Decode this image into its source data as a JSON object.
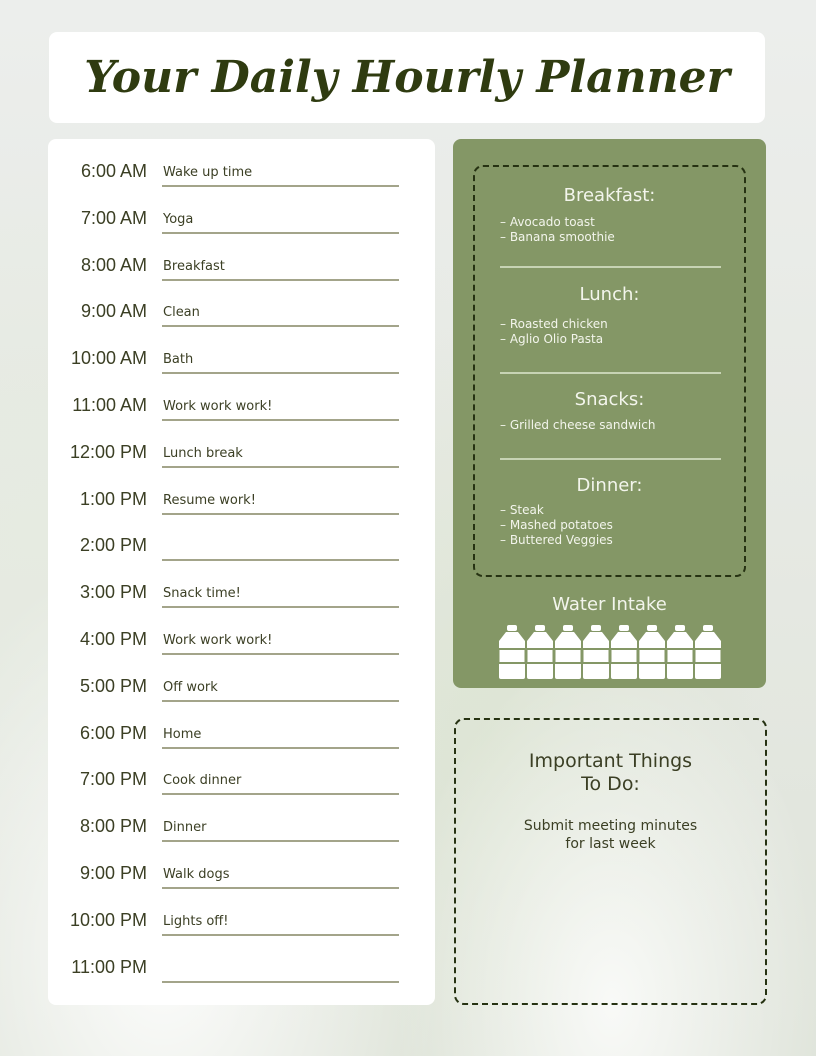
{
  "header": {
    "title": "Your Daily Hourly Planner"
  },
  "schedule": [
    {
      "time": "6:00 AM",
      "task": "Wake up time"
    },
    {
      "time": "7:00 AM",
      "task": "Yoga"
    },
    {
      "time": "8:00 AM",
      "task": "Breakfast"
    },
    {
      "time": "9:00 AM",
      "task": "Clean"
    },
    {
      "time": "10:00 AM",
      "task": "Bath"
    },
    {
      "time": "11:00 AM",
      "task": "Work work work!"
    },
    {
      "time": "12:00 PM",
      "task": "Lunch break"
    },
    {
      "time": "1:00 PM",
      "task": "Resume work!"
    },
    {
      "time": "2:00 PM",
      "task": ""
    },
    {
      "time": "3:00 PM",
      "task": "Snack time!"
    },
    {
      "time": "4:00 PM",
      "task": "Work work work!"
    },
    {
      "time": "5:00 PM",
      "task": "Off work"
    },
    {
      "time": "6:00 PM",
      "task": "Home"
    },
    {
      "time": "7:00 PM",
      "task": "Cook dinner"
    },
    {
      "time": "8:00 PM",
      "task": "Dinner"
    },
    {
      "time": "9:00 PM",
      "task": "Walk dogs"
    },
    {
      "time": "10:00 PM",
      "task": "Lights off!"
    },
    {
      "time": "11:00 PM",
      "task": ""
    }
  ],
  "meals": {
    "breakfast": {
      "title": "Breakfast:",
      "items": [
        "– Avocado toast",
        "– Banana smoothie"
      ]
    },
    "lunch": {
      "title": "Lunch:",
      "items": [
        "– Roasted chicken",
        "– Aglio Olio Pasta"
      ]
    },
    "snacks": {
      "title": "Snacks:",
      "items": [
        "– Grilled cheese sandwich"
      ]
    },
    "dinner": {
      "title": "Dinner:",
      "items": [
        "– Steak",
        "– Mashed potatoes",
        "– Buttered Veggies"
      ]
    }
  },
  "water": {
    "label": "Water Intake",
    "bottle_count": 8,
    "icon": "water-bottle-icon"
  },
  "todo": {
    "title_line1": "Important Things",
    "title_line2": "To Do:",
    "item_line1": "Submit meeting minutes",
    "item_line2": "for last week"
  },
  "colors": {
    "panel_green": "#849766",
    "title_text": "#2f3b10",
    "body_text": "#3b3f24",
    "line": "#a3a48a"
  }
}
